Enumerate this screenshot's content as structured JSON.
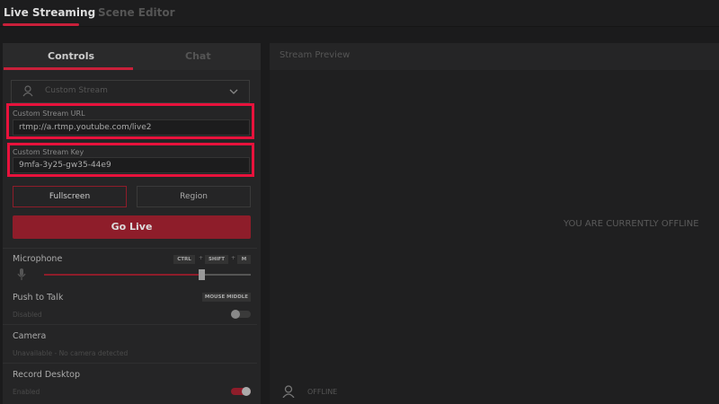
{
  "top_tabs": [
    "Live Streaming",
    "Scene Editor"
  ],
  "sub_tabs": [
    "Controls",
    "Chat"
  ],
  "stream_select": "Custom Stream",
  "url": {
    "label": "Custom Stream URL",
    "value": "rtmp://a.rtmp.youtube.com/live2"
  },
  "key": {
    "label": "Custom Stream Key",
    "value": "9mfa-3y25-gw35-44e9"
  },
  "capture": {
    "fullscreen": "Fullscreen",
    "region": "Region"
  },
  "go_live": "Go Live",
  "microphone": {
    "label": "Microphone",
    "hotkeys": [
      "CTRL",
      "SHIFT",
      "M"
    ],
    "separator": "+",
    "volume_percent": 76
  },
  "push_to_talk": {
    "label": "Push to Talk",
    "status": "Disabled",
    "hotkey": "MOUSE MIDDLE",
    "enabled": false
  },
  "camera": {
    "label": "Camera",
    "status": "Unavailable - No camera detected"
  },
  "record_desktop": {
    "label": "Record Desktop",
    "status": "Enabled",
    "enabled": true
  },
  "preview": {
    "title": "Stream Preview",
    "message": "YOU ARE CURRENTLY OFFLINE",
    "status": "OFFLINE"
  },
  "colors": {
    "accent": "#c8203a",
    "highlight": "#e8123c"
  }
}
